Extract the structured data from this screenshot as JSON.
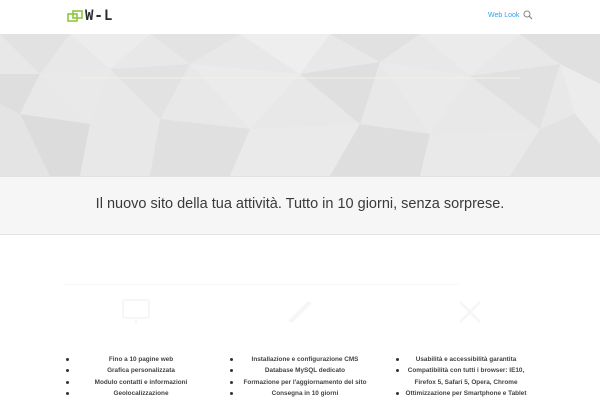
{
  "header": {
    "logo_text": "W-L",
    "nav": [
      {
        "label": "Web Look"
      }
    ],
    "logo_mark_color": "#8dc63f",
    "accent_color": "#2ea3f2"
  },
  "hero": {
    "background_color": "#e7e7e7"
  },
  "tagline": {
    "text": "Il nuovo sito della tua attività. Tutto in 10 giorni, senza sorprese."
  },
  "features": {
    "columns": [
      {
        "icon": "monitor-icon",
        "items": [
          "Fino a 10 pagine web",
          "Grafica personalizzata",
          "Modulo contatti e informazioni",
          "Geolocalizzazione"
        ]
      },
      {
        "icon": "pencil-icon",
        "items": [
          "Installazione e configurazione CMS",
          "Database MySQL dedicato",
          "Formazione per l'aggiornamento del sito",
          "Consegna in 10 giorni"
        ]
      },
      {
        "icon": "tools-icon",
        "items": [
          "Usabilità e accessibilità garantita",
          "Compatibilità con tutti i browser: IE10,",
          "Firefox 5, Safari 5, Opera, Chrome",
          "Ottimizzazione per Smartphone e Tablet"
        ]
      }
    ]
  }
}
